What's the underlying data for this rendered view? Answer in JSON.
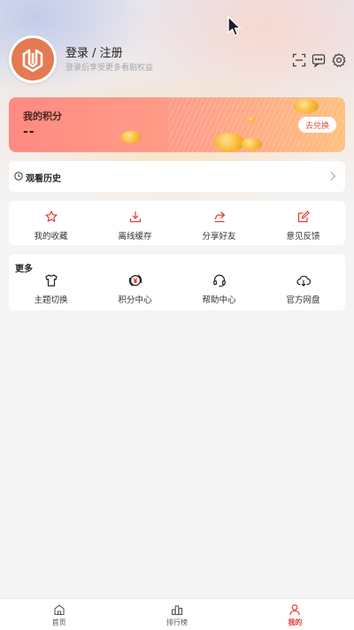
{
  "header": {
    "login_title": "登录 / 注册",
    "login_subtitle": "登录后享受更多看剧权益",
    "icons": [
      "scan-icon",
      "message-icon",
      "settings-icon"
    ]
  },
  "points": {
    "label": "我的积分",
    "value": "--",
    "redeem_label": "去兑换"
  },
  "history": {
    "label": "观看历史"
  },
  "quick_actions": [
    {
      "label": "我的收藏",
      "icon": "star-icon"
    },
    {
      "label": "离线缓存",
      "icon": "download-icon"
    },
    {
      "label": "分享好友",
      "icon": "share-icon"
    },
    {
      "label": "意见反馈",
      "icon": "edit-icon"
    }
  ],
  "more": {
    "title": "更多",
    "items": [
      {
        "label": "主题切换",
        "icon": "shirt-icon"
      },
      {
        "label": "积分中心",
        "icon": "yen-coin-icon"
      },
      {
        "label": "帮助中心",
        "icon": "headset-icon"
      },
      {
        "label": "官方网盘",
        "icon": "cloud-download-icon"
      }
    ]
  },
  "tabbar": [
    {
      "label": "首页",
      "icon": "home-icon",
      "active": false
    },
    {
      "label": "排行榜",
      "icon": "ranking-icon",
      "active": false
    },
    {
      "label": "我的",
      "icon": "user-icon",
      "active": true
    }
  ],
  "colors": {
    "accent": "#e53935",
    "avatar": "#e57a52",
    "redeem_text": "#e74b3c"
  }
}
